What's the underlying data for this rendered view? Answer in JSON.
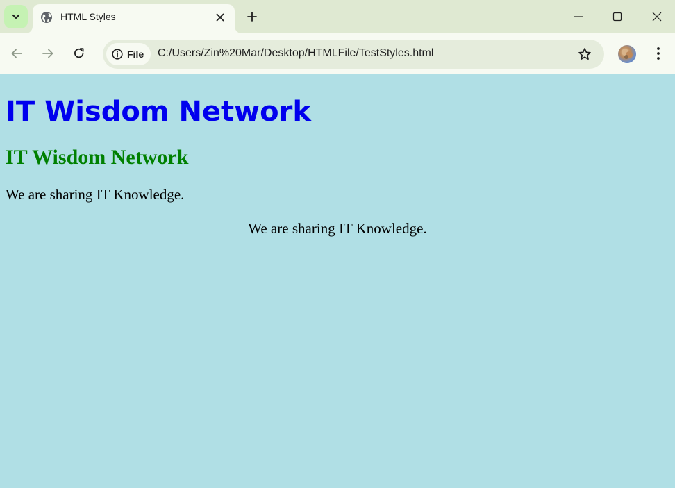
{
  "browser": {
    "tab": {
      "title": "HTML Styles",
      "favicon": "globe-icon"
    },
    "icons": {
      "tab_search": "chevron-down-icon",
      "tab_close": "close-icon",
      "new_tab": "plus-icon",
      "minimize": "minimize-icon",
      "maximize": "maximize-icon",
      "close_window": "close-icon",
      "back": "arrow-left-icon",
      "forward": "arrow-right-icon",
      "reload": "reload-icon",
      "site_info": "info-icon",
      "bookmark": "star-icon",
      "menu": "kebab-menu-icon"
    },
    "omnibox": {
      "scheme_label": "File",
      "url": "C:/Users/Zin%20Mar/Desktop/HTMLFile/TestStyles.html"
    },
    "colors": {
      "tabstrip": "#dfe9d2",
      "toolbar": "#f7faf2",
      "omnibox": "#e5ecdc"
    }
  },
  "page": {
    "heading1": "IT Wisdom Network",
    "heading2": "IT Wisdom Network",
    "paragraph1": "We are sharing IT Knowledge.",
    "paragraph2_centered": "We are sharing IT Knowledge.",
    "colors": {
      "background": "#b0dfe5",
      "heading1": "#0000ee",
      "heading2": "#008000",
      "paragraph": "#000000"
    }
  }
}
